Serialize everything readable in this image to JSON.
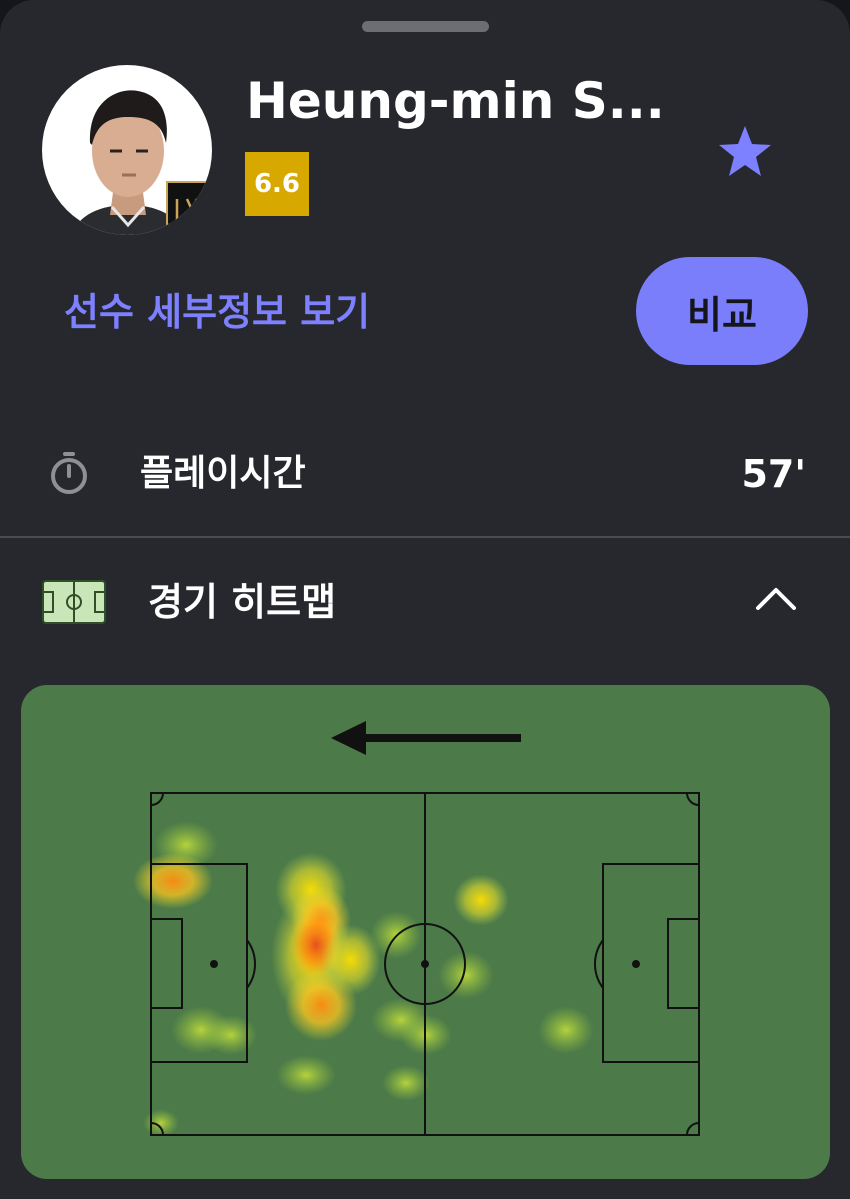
{
  "player": {
    "name": "Heung-min S...",
    "rating": "6.6",
    "rating_color": "#d6a800",
    "club_badge_icon": "lafc-crest-icon",
    "favorite_icon": "star-icon"
  },
  "actions": {
    "detail_link": "선수 세부정보 보기",
    "compare_button": "비교"
  },
  "stats": {
    "playtime_label": "플레이시간",
    "playtime_value": "57'",
    "playtime_icon": "stopwatch-icon"
  },
  "heatmap_section": {
    "title": "경기 히트맵",
    "icon": "pitch-icon",
    "toggle_icon": "chevron-up-icon",
    "direction_icon": "arrow-left-icon"
  },
  "colors": {
    "accent": "#7d80ff",
    "button": "#7b7efb",
    "background": "#26282e",
    "pitch": "#4c7a48"
  }
}
